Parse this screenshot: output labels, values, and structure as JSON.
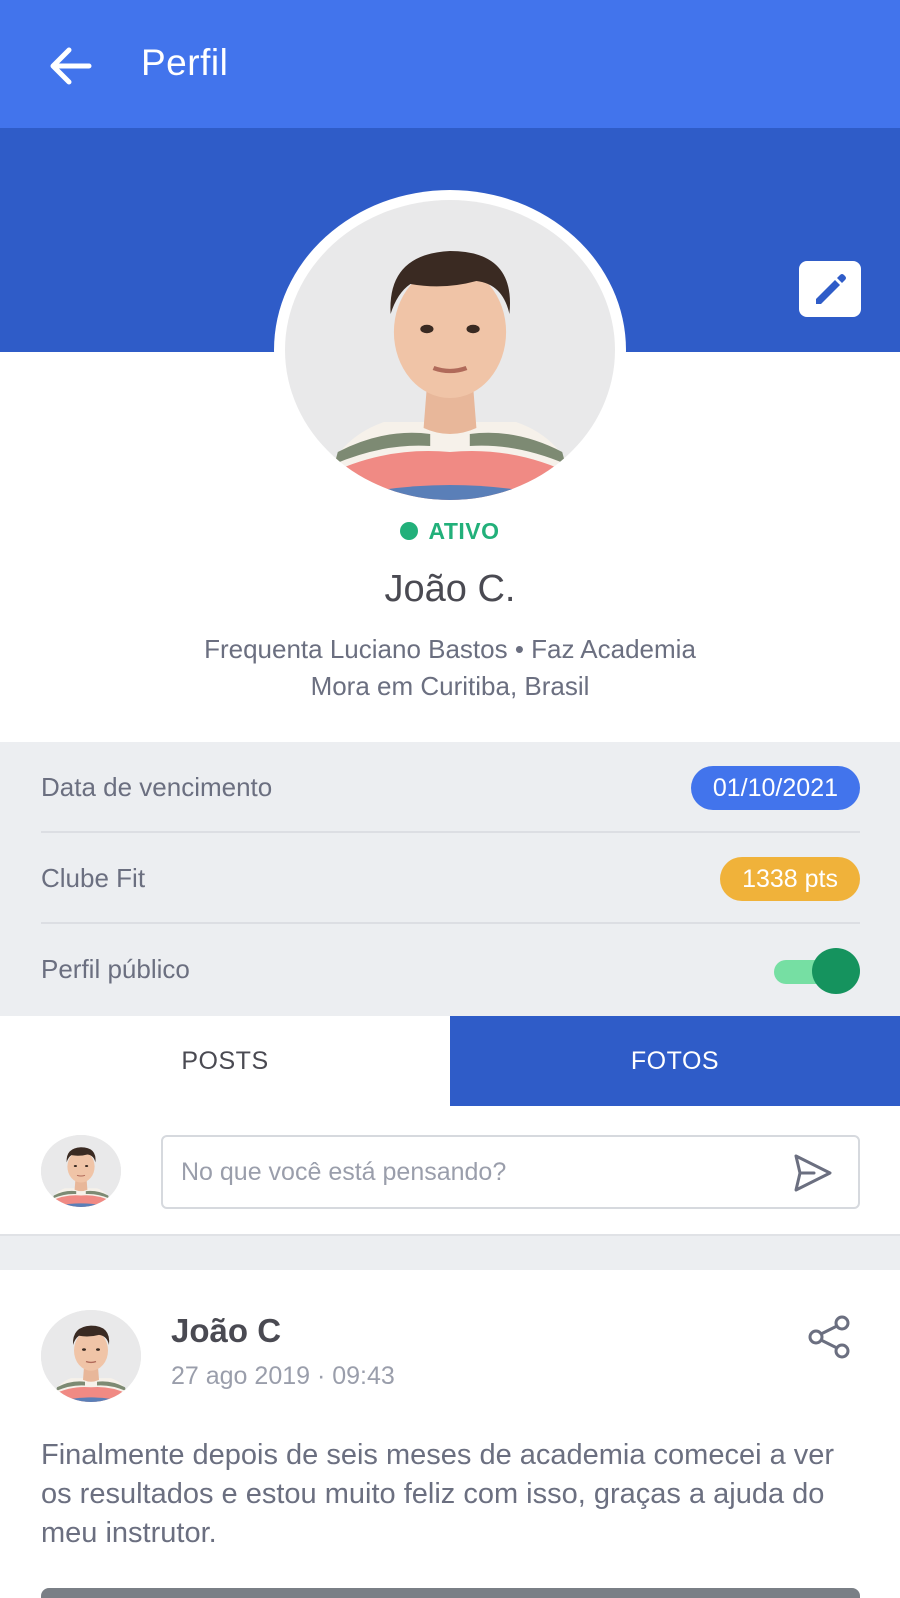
{
  "appbar": {
    "title": "Perfil",
    "back_icon": "arrow-left-icon"
  },
  "profile": {
    "edit_icon": "pencil-icon",
    "status": "ATIVO",
    "name": "João C.",
    "info_line1": "Frequenta Luciano Bastos • Faz Academia",
    "info_line2": "Mora em Curitiba, Brasil"
  },
  "stats": {
    "due_date_label": "Data de vencimento",
    "due_date_value": "01/10/2021",
    "club_label": "Clube Fit",
    "club_value": "1338 pts",
    "public_label": "Perfil público",
    "public_enabled": true
  },
  "tabs": [
    {
      "label": "POSTS",
      "active": false
    },
    {
      "label": "FOTOS",
      "active": true
    }
  ],
  "composer": {
    "placeholder": "No que você está pensando?",
    "send_icon": "send-icon"
  },
  "post": {
    "author": "João C",
    "date": "27 ago 2019 · 09:43",
    "text": "Finalmente depois de seis meses de academia comecei a ver os resultados e estou muito feliz com isso, graças a ajuda do meu instrutor.",
    "share_icon": "share-icon"
  },
  "colors": {
    "primary": "#4274ec",
    "primary_dark": "#2f5cc8",
    "active_green": "#22b07a",
    "points_yellow": "#f0b23a"
  }
}
